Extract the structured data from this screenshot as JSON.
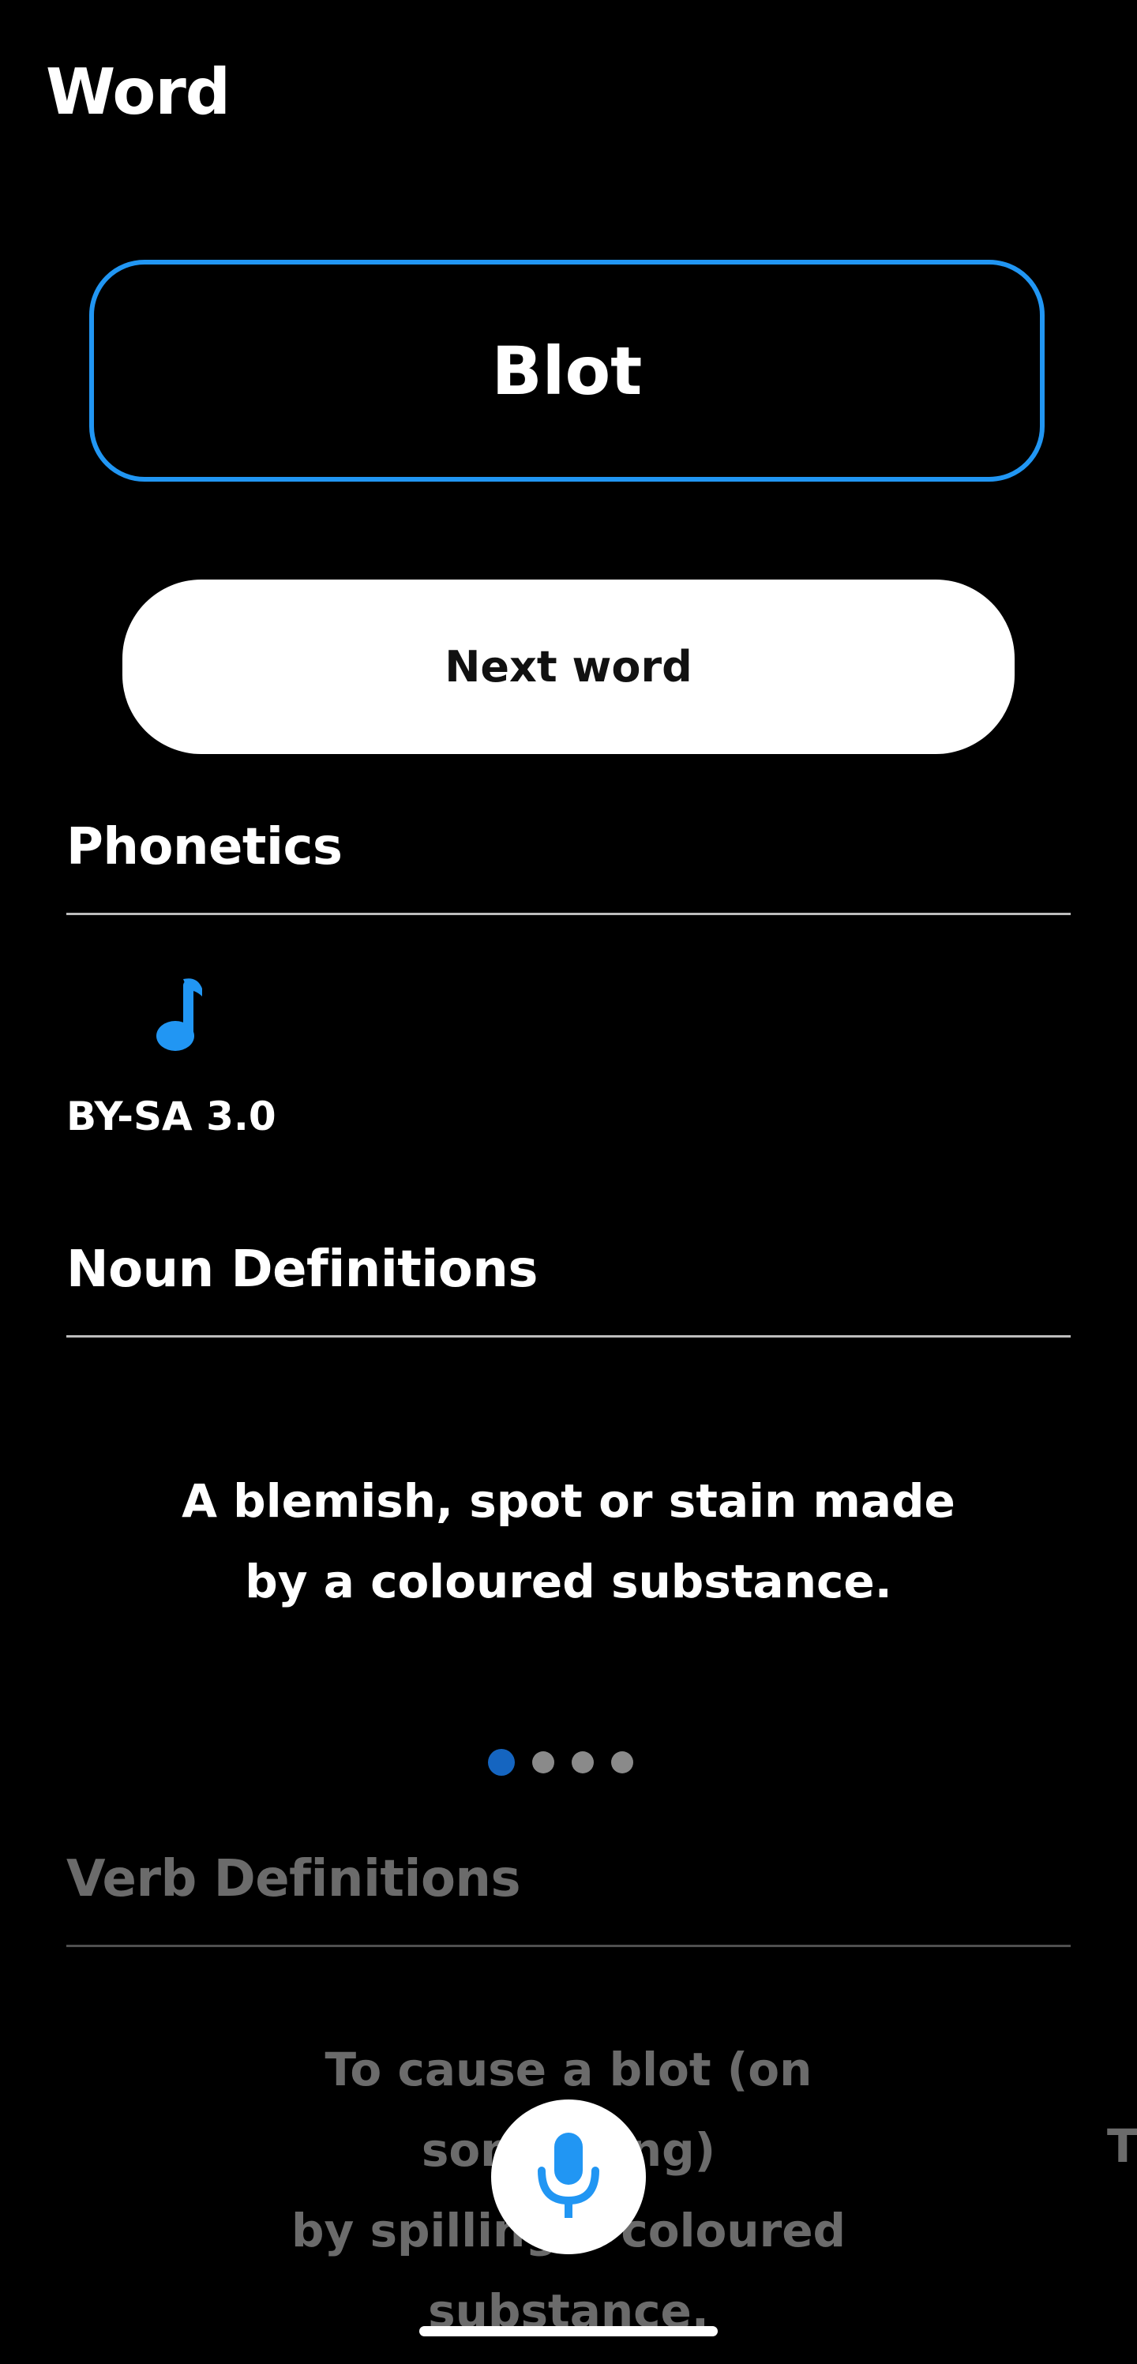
{
  "app": {
    "title": "Word"
  },
  "word": {
    "value": "Blot"
  },
  "actions": {
    "next_word_label": "Next word"
  },
  "phonetics": {
    "heading": "Phonetics",
    "audio_icon": "music-note-icon",
    "license": "BY-SA 3.0"
  },
  "noun": {
    "heading": "Noun Definitions",
    "definition_line1": "A blemish, spot or stain made",
    "definition_line2": "by a coloured substance.",
    "page_count": 4,
    "current_page": 1
  },
  "verb": {
    "heading": "Verb Definitions",
    "definition_line1": "To cause a blot (on something)",
    "definition_line2": "by spilling a coloured",
    "definition_line3": "substance.",
    "next_definition_peek": "T"
  },
  "voice": {
    "icon": "microphone-icon"
  },
  "colors": {
    "background": "#000000",
    "accent": "#2196f3",
    "active_dot": "#1565c0",
    "inactive_dot": "#8a8a8a",
    "divider": "#bdbdbd"
  }
}
